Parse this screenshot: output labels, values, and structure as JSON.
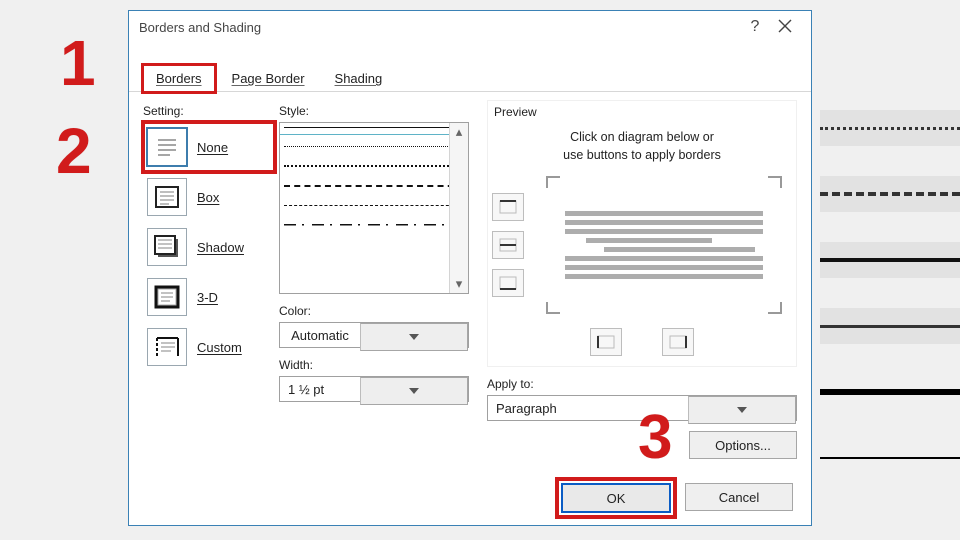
{
  "annotations": {
    "n1": "1",
    "n2": "2",
    "n3": "3"
  },
  "dialog": {
    "title": "Borders and Shading",
    "help": "?",
    "tabs": {
      "borders": "Borders",
      "page_border": "Page Border",
      "shading": "Shading"
    },
    "setting": {
      "label": "Setting:",
      "none": "None",
      "box": "Box",
      "shadow": "Shadow",
      "threeD": "3-D",
      "custom": "Custom"
    },
    "style": {
      "label": "Style:",
      "color_label": "Color:",
      "color_value": "Automatic",
      "width_label": "Width:",
      "width_value": "1 ½ pt"
    },
    "preview": {
      "label": "Preview",
      "hint1": "Click on diagram below or",
      "hint2": "use buttons to apply borders",
      "apply_label": "Apply to:",
      "apply_value": "Paragraph",
      "options": "Options..."
    },
    "buttons": {
      "ok": "OK",
      "cancel": "Cancel"
    }
  }
}
